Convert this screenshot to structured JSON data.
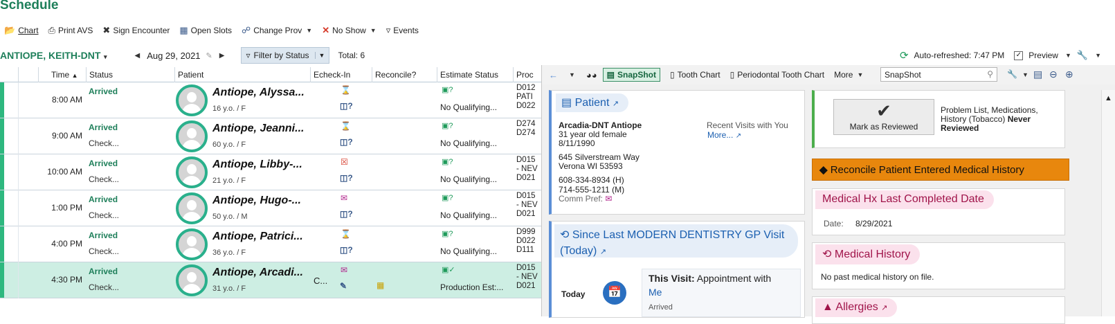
{
  "app": {
    "title": "Schedule"
  },
  "toolbar": {
    "chart": "Chart",
    "print_avs": "Print AVS",
    "sign_encounter": "Sign Encounter",
    "open_slots": "Open Slots",
    "change_prov": "Change Prov",
    "no_show": "No Show",
    "events": "Events"
  },
  "subbar": {
    "provider": "ANTIOPE, KEITH-DNT",
    "date": "Aug 29, 2021",
    "filter": "Filter by Status",
    "total": "Total: 6",
    "auto_refreshed": "Auto-refreshed: 7:47 PM",
    "preview": "Preview"
  },
  "grid": {
    "headers": {
      "time": "Time",
      "status": "Status",
      "patient": "Patient",
      "echeck": "Echeck-In",
      "reconcile": "Reconcile?",
      "estimate": "Estimate Status",
      "proc": "Proc"
    },
    "rows": [
      {
        "time": "8:00 AM",
        "status1": "Arrived",
        "status2": "",
        "name": "Antiope, Alyssa...",
        "age": "16 y.o. / F",
        "estimate": "No Qualifying...",
        "proc": [
          "D012",
          "PATI",
          "D022"
        ],
        "echeck_text": "",
        "selected": false
      },
      {
        "time": "9:00 AM",
        "status1": "Arrived",
        "status2": "Check...",
        "name": "Antiope, Jeanni...",
        "age": "60 y.o. / F",
        "estimate": "No Qualifying...",
        "proc": [
          "D274",
          "",
          "D274"
        ],
        "echeck_text": "",
        "selected": false
      },
      {
        "time": "10:00 AM",
        "status1": "Arrived",
        "status2": "Check...",
        "name": "Antiope, Libby-...",
        "age": "21 y.o. / F",
        "estimate": "No Qualifying...",
        "proc": [
          "D015",
          "- NEV",
          "D021"
        ],
        "echeck_text": "",
        "selected": false
      },
      {
        "time": "1:00 PM",
        "status1": "Arrived",
        "status2": "Check...",
        "name": "Antiope, Hugo-...",
        "age": "50 y.o. / M",
        "estimate": "No Qualifying...",
        "proc": [
          "D015",
          "- NEV",
          "D021"
        ],
        "echeck_text": "",
        "selected": false
      },
      {
        "time": "4:00 PM",
        "status1": "Arrived",
        "status2": "Check...",
        "name": "Antiope, Patrici...",
        "age": "36 y.o. / F",
        "estimate": "No Qualifying...",
        "proc": [
          "D999",
          "D022",
          "D111"
        ],
        "echeck_text": "",
        "selected": false
      },
      {
        "time": "4:30 PM",
        "status1": "Arrived",
        "status2": "Check...",
        "name": "Antiope, Arcadi...",
        "age": "31 y.o. / F",
        "estimate": "Production Est:...",
        "proc": [
          "D015",
          "- NEV",
          "D021"
        ],
        "echeck_text": "C...",
        "selected": true
      }
    ]
  },
  "panel": {
    "tabs": {
      "snapshot": "SnapShot",
      "tooth_chart": "Tooth Chart",
      "perio": "Periodontal Tooth Chart",
      "more": "More"
    },
    "search_value": "SnapShot",
    "patient_card": {
      "title": "Patient",
      "name": "Arcadia-DNT Antiope",
      "age_sex": "31 year old female",
      "dob": "8/11/1990",
      "addr1": "645 Silverstream Way",
      "addr2": "Verona WI 53593",
      "phone_h": "608-334-8934 (H)",
      "phone_m": "714-555-1211 (M)",
      "comm_pref": "Comm Pref:",
      "recent_visits": "Recent Visits with You",
      "more": "More..."
    },
    "visit_card": {
      "title_line1": "Since Last MODERN DENTISTRY GP Visit",
      "title_line2": "(Today)",
      "today": "Today",
      "this_visit_label": "This Visit:",
      "this_visit_value": "Appointment with",
      "me": "Me",
      "arrived": "Arrived"
    },
    "review_card": {
      "button": "Mark as Reviewed",
      "text1": "Problem List, Medications,",
      "text2": "History (Tobacco)",
      "never": "Never",
      "reviewed": "Reviewed"
    },
    "reconcile_bar": "Reconcile Patient Entered Medical History",
    "medhx_card": {
      "title": "Medical Hx Last Completed Date",
      "date_label": "Date:",
      "date_value": "8/29/2021"
    },
    "medhistory_card": {
      "title": "Medical History",
      "text": "No past medical history on file."
    },
    "allergies_card": {
      "title": "Allergies"
    }
  },
  "colors": {
    "accent_green": "#1e7f5a",
    "stripe_green": "#2eb87f",
    "link_blue": "#1b5fb0",
    "orange": "#e8870d",
    "pink": "#a0144a"
  }
}
